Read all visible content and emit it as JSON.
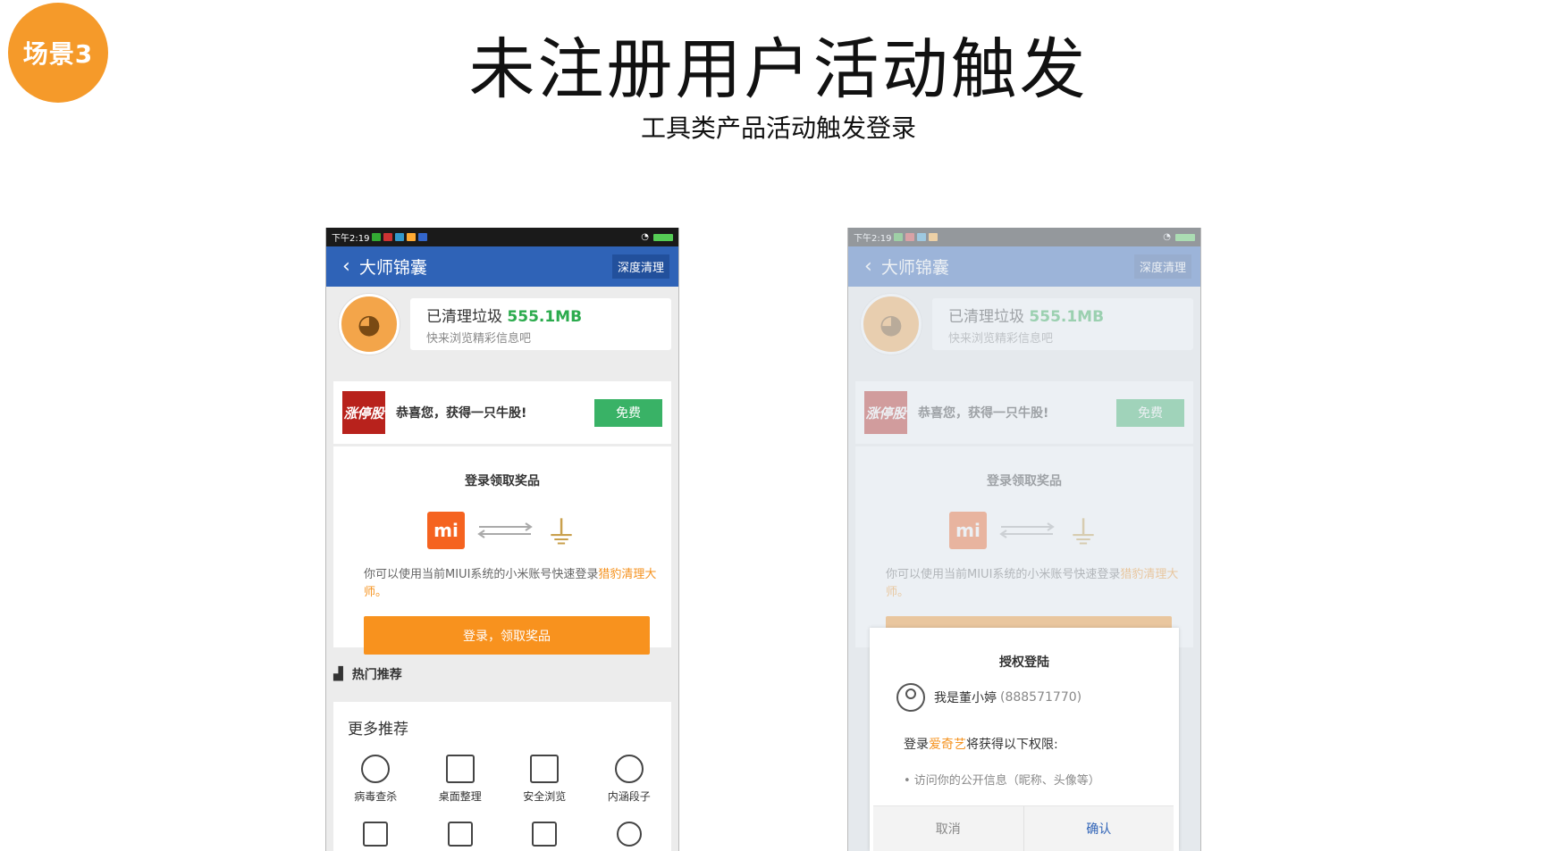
{
  "badge": "场景3",
  "title": "未注册用户活动触发",
  "subtitle": "工具类产品活动触发登录",
  "phone": {
    "time": "下午2:19",
    "appbar_title": "大师锦囊",
    "deep_clean": "深度清理",
    "cleaned_label": "已清理垃圾",
    "cleaned_amount": "555.1MB",
    "cleaned_sub": "快来浏览精彩信息吧",
    "promo_img_text": "涨停股",
    "promo_text": "恭喜您，获得一只牛股!",
    "free_button": "免费",
    "login_title": "登录领取奖品",
    "mi_logo": "mi",
    "login_desc": "你可以使用当前MIUI系统的小米账号快速登录",
    "login_desc_app": "猎豹清理大师。",
    "login_button": "登录，领取奖品",
    "hot_label": "热门推荐",
    "more_title": "更多推荐",
    "tools": [
      "病毒查杀",
      "桌面整理",
      "安全浏览",
      "内涵段子"
    ]
  },
  "dialog": {
    "title": "授权登陆",
    "user_name": "我是董小婷",
    "user_id": "(888571770)",
    "perm_prefix": "登录",
    "perm_app": "爱奇艺",
    "perm_suffix": "将获得以下权限:",
    "perm_item": "• 访问你的公开信息（昵称、头像等）",
    "cancel": "取消",
    "confirm": "确认"
  },
  "colors": {
    "badge": "#f59a2a",
    "appbar": "#2f63b7",
    "accent_orange": "#f8921e",
    "green": "#39b266"
  }
}
